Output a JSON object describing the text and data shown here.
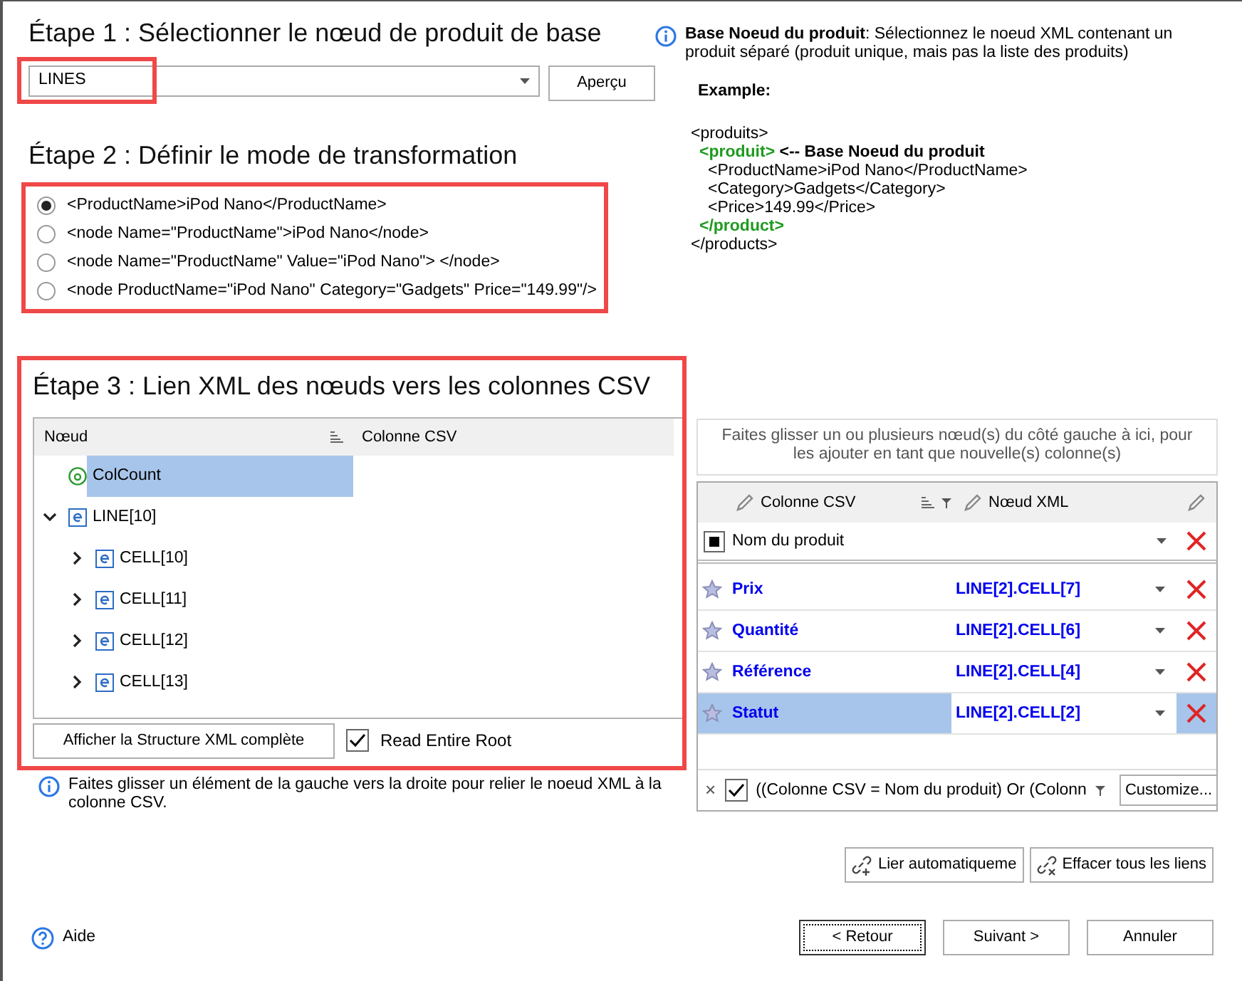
{
  "step1": {
    "title": "Étape 1 : Sélectionner le nœud de produit de base",
    "select_value": "LINES",
    "preview_button": "Aperçu"
  },
  "step2": {
    "title": "Étape 2 : Définir le mode de transformation",
    "options": [
      {
        "label": "<ProductName>iPod Nano</ProductName>",
        "selected": true
      },
      {
        "label": "<node Name=\"ProductName\">iPod Nano</node>",
        "selected": false
      },
      {
        "label": "<node Name=\"ProductName\" Value=\"iPod Nano\"> </node>",
        "selected": false
      },
      {
        "label": "<node ProductName=\"iPod Nano\" Category=\"Gadgets\" Price=\"149.99\"/>",
        "selected": false
      }
    ]
  },
  "info": {
    "text": "**Base Noeud du produit**: Sélectionnez le noeud XML contenant un produit séparé (produit unique, mais pas la liste des produits)",
    "example_label": "Example:",
    "example": {
      "open": "<produits>",
      "close": "</products>",
      "highlight": false,
      "children": [
        {
          "open": "<produit>",
          "comment": "<-- Base Noeud du produit",
          "close": "</product>",
          "highlight": true,
          "children": [
            {
              "open": "<ProductName>iPod Nano</ProductName>",
              "highlight": false
            },
            {
              "open": "<Category>Gadgets</Category>",
              "highlight": false
            },
            {
              "open": "<Price>149.99</Price>",
              "highlight": false
            }
          ]
        }
      ]
    }
  },
  "step3": {
    "title": "Étape 3 : Lien XML des nœuds vers les colonnes CSV",
    "columns": [
      "Nœud",
      "Colonne CSV"
    ],
    "tree": [
      {
        "label": "ColCount",
        "kind": "attribute",
        "selected": true
      },
      {
        "label": "LINE[10]",
        "kind": "element",
        "selected": false,
        "expanded": true,
        "children": [
          {
            "label": "CELL[10]",
            "kind": "element",
            "selected": false,
            "expanded": false
          },
          {
            "label": "CELL[11]",
            "kind": "element",
            "selected": false,
            "expanded": false
          },
          {
            "label": "CELL[12]",
            "kind": "element",
            "selected": false,
            "expanded": false
          },
          {
            "label": "CELL[13]",
            "kind": "element",
            "selected": false,
            "expanded": false
          }
        ]
      }
    ],
    "show_structure_button": "Afficher la Structure XML complète",
    "read_root": {
      "label": "Read Entire Root",
      "checked": true
    },
    "hint": "Faites glisser un élément de la gauche vers la droite pour relier le noeud XML à la colonne CSV."
  },
  "mapping": {
    "drop_hint": "Faites glisser un ou plusieurs nœud(s) du côté gauche à ici, pour les ajouter en tant que nouvelle(s) colonne(s)",
    "columns": [
      "Colonne CSV",
      "Nœud XML"
    ],
    "new_row": "Nom du produit",
    "rows": [
      {
        "csv": "Prix",
        "xml": "LINE[2].CELL[7]",
        "selected": false
      },
      {
        "csv": "Quantité",
        "xml": "LINE[2].CELL[6]",
        "selected": false
      },
      {
        "csv": "Référence",
        "xml": "LINE[2].CELL[4]",
        "selected": false
      },
      {
        "csv": "Statut",
        "xml": "LINE[2].CELL[2]",
        "selected": true
      }
    ],
    "filter": {
      "clear": "×",
      "checked": true,
      "text": "((Colonne CSV = Nom du produit) Or (Colonn",
      "customize_button": "Customize..."
    }
  },
  "link_buttons": [
    {
      "label": "Lier automatiqueme",
      "kind": "auto"
    },
    {
      "label": "Effacer tous les liens",
      "kind": "clear"
    }
  ],
  "help": "Aide",
  "footer_buttons": [
    {
      "label": "< Retour",
      "focused": true
    },
    {
      "label": "Suivant >",
      "focused": false
    },
    {
      "label": "Annuler",
      "focused": false
    }
  ]
}
